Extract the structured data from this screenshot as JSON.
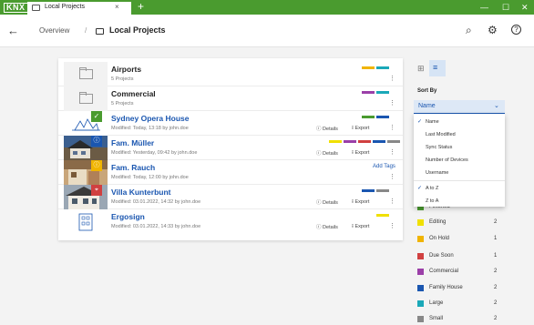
{
  "titlebar": {
    "logo": "KNX",
    "tab_label": "Local Projects",
    "tab_close": "×",
    "tab_add": "+",
    "minimize": "—",
    "maximize": "☐",
    "close": "✕",
    "color": "#4a9b2f"
  },
  "header": {
    "back": "←",
    "crumb_overview": "Overview",
    "crumb_sep": "/",
    "crumb_current": "Local Projects",
    "search_icon": "⌕",
    "settings_icon": "⚙",
    "help_icon": "?"
  },
  "projects": [
    {
      "title": "Airports",
      "sub": "5 Projects",
      "type": "folder",
      "tags": [
        "#f0b400",
        "#1aa8b8"
      ]
    },
    {
      "title": "Commercial",
      "sub": "5 Projects",
      "type": "folder",
      "tags": [
        "#9b3fa8",
        "#1aa8b8"
      ]
    },
    {
      "title": "Sydney Opera House",
      "sub": "Modified: Today, 13:18 by john.doe",
      "type": "project",
      "tags": [
        "#4a9b2f",
        "#1a56b0"
      ]
    },
    {
      "title": "Fam. Müller",
      "sub": "Modified: Yesterday, 09:42 by john.doe",
      "type": "project",
      "tags": [
        "#f0e000",
        "#9b3fa8",
        "#d04040",
        "#1a56b0",
        "#888888"
      ]
    },
    {
      "title": "Fam. Rauch",
      "sub": "Modified: Today, 12:00 by john.doe",
      "type": "project",
      "add_tags": "Add Tags"
    },
    {
      "title": "Villa Kunterbunt",
      "sub": "Modified: 03.01.2022, 14:32 by john.doe",
      "type": "project",
      "tags": [
        "#1a56b0",
        "#888888"
      ]
    },
    {
      "title": "Ergosign",
      "sub": "Modified: 03.01.2022, 14:33 by john.doe",
      "type": "project",
      "tags": [
        "#f0e000"
      ]
    }
  ],
  "actions": {
    "details": "Details",
    "export": "Export",
    "kebab": "⋮",
    "info_icon": "ⓘ",
    "export_icon": "⭱",
    "check": "✓",
    "badge_info": "ⓘ",
    "badge_pin": "⌖"
  },
  "sort": {
    "label": "Sort By",
    "value": "Name",
    "chevron": "⌄",
    "options": [
      "Name",
      "Last Modified",
      "Sync Status",
      "Number of Devices",
      "Username"
    ],
    "order": [
      "A to Z",
      "Z to A"
    ],
    "check": "✓"
  },
  "filters": [
    {
      "label": "Finished",
      "count": "",
      "color": "#4a9b2f"
    },
    {
      "label": "Editing",
      "count": "2",
      "color": "#f0e000"
    },
    {
      "label": "On Hold",
      "count": "1",
      "color": "#f0b400"
    },
    {
      "label": "Due Soon",
      "count": "1",
      "color": "#d04040"
    },
    {
      "label": "Commercial",
      "count": "2",
      "color": "#9b3fa8"
    },
    {
      "label": "Family House",
      "count": "2",
      "color": "#1a56b0"
    },
    {
      "label": "Large",
      "count": "2",
      "color": "#1aa8b8"
    },
    {
      "label": "Small",
      "count": "2",
      "color": "#888888"
    }
  ]
}
